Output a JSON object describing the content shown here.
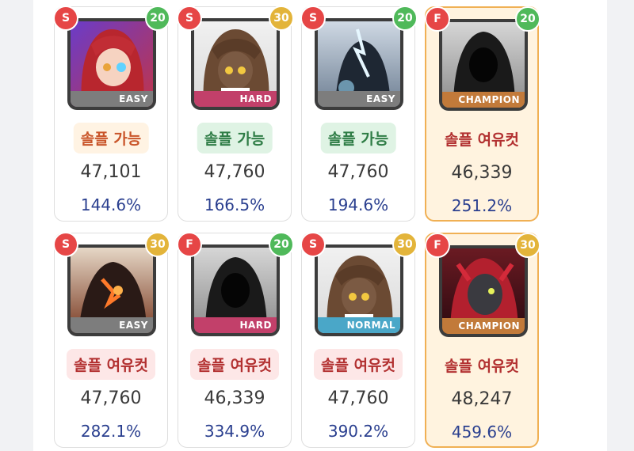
{
  "colors": {
    "grade_S": "#e64646",
    "grade_F": "#e64646",
    "level_20": "#4fb95a",
    "level_30": "#e3b43a",
    "diff_easy": "#7d7d7d",
    "diff_hard": "#c2406a",
    "diff_normal": "#4aa7c8",
    "diff_champion": "#c27a3a"
  },
  "cards": [
    {
      "grade": "S",
      "level": "20",
      "difficulty": "EASY",
      "status": "솔플 가능",
      "status_color": "orange",
      "combat": "47,101",
      "ratio": "144.6%",
      "highlight": false,
      "art": "red-hair-girl-icon"
    },
    {
      "grade": "S",
      "level": "30",
      "difficulty": "HARD",
      "status": "솔플 가능",
      "status_color": "green",
      "combat": "47,760",
      "ratio": "166.5%",
      "highlight": false,
      "art": "brown-hair-girl-icon"
    },
    {
      "grade": "S",
      "level": "20",
      "difficulty": "EASY",
      "status": "솔플 가능",
      "status_color": "green",
      "combat": "47,760",
      "ratio": "194.6%",
      "highlight": false,
      "art": "dark-figure-icon"
    },
    {
      "grade": "F",
      "level": "20",
      "difficulty": "CHAMPION",
      "status": "솔플 여유컷",
      "status_color": "red",
      "combat": "46,339",
      "ratio": "251.2%",
      "highlight": true,
      "art": "hooded-figure-icon"
    },
    {
      "grade": "S",
      "level": "30",
      "difficulty": "EASY",
      "status": "솔플 여유컷",
      "status_color": "red",
      "combat": "47,760",
      "ratio": "282.1%",
      "highlight": false,
      "art": "fire-beast-icon"
    },
    {
      "grade": "F",
      "level": "20",
      "difficulty": "HARD",
      "status": "솔플 여유컷",
      "status_color": "red",
      "combat": "46,339",
      "ratio": "334.9%",
      "highlight": false,
      "art": "hooded-figure-icon"
    },
    {
      "grade": "S",
      "level": "30",
      "difficulty": "NORMAL",
      "status": "솔플 여유컷",
      "status_color": "red",
      "combat": "47,760",
      "ratio": "390.2%",
      "highlight": false,
      "art": "brown-hair-girl-icon"
    },
    {
      "grade": "F",
      "level": "30",
      "difficulty": "CHAMPION",
      "status": "솔플 여유컷",
      "status_color": "red",
      "combat": "48,247",
      "ratio": "459.6%",
      "highlight": true,
      "art": "red-demon-icon"
    }
  ]
}
